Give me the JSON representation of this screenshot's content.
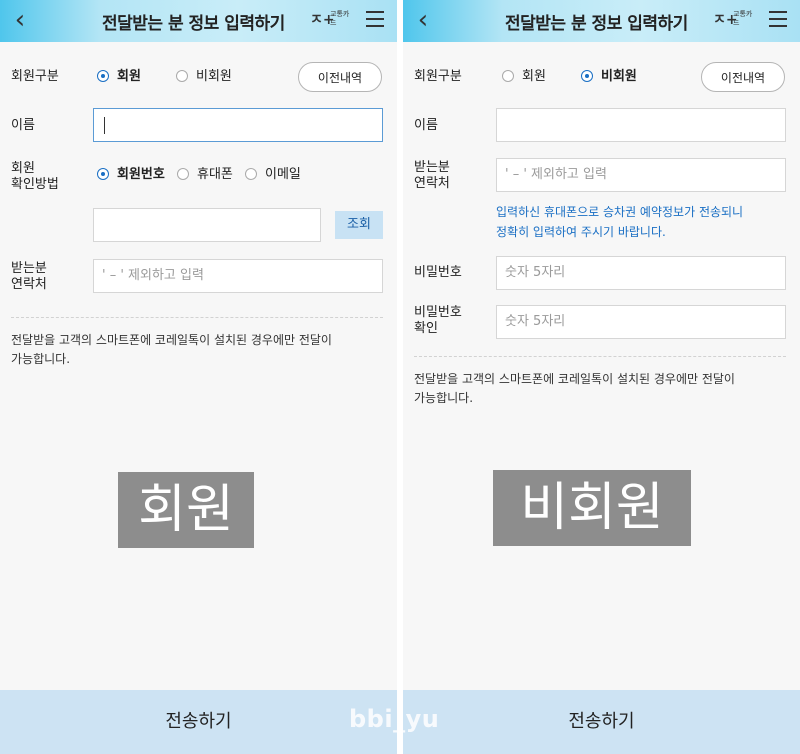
{
  "left": {
    "header": {
      "back_icon": "‹",
      "title": "전달받는 분 정보 입력하기",
      "logo_mark": "ㅈ+",
      "logo_text": "교통카드"
    },
    "member_type": {
      "label": "회원구분",
      "options": [
        "회원",
        "비회원"
      ],
      "selected": "회원",
      "history_button": "이전내역"
    },
    "name": {
      "label": "이름",
      "value": ""
    },
    "verify": {
      "label_line1": "회원",
      "label_line2": "확인방법",
      "options": [
        "회원번호",
        "휴대폰",
        "이메일"
      ],
      "selected": "회원번호"
    },
    "lookup": {
      "value": "",
      "button": "조회"
    },
    "contact": {
      "label_line1": "받는분",
      "label_line2": "연락처",
      "placeholder": "' – ' 제외하고 입력"
    },
    "notice_line1": "전달받을 고객의 스마트폰에 코레일톡이 설치된 경우에만 전달이",
    "notice_line2": "가능합니다.",
    "overlay_text": "회원",
    "submit": "전송하기"
  },
  "right": {
    "header": {
      "back_icon": "‹",
      "title": "전달받는 분 정보 입력하기",
      "logo_mark": "ㅈ+",
      "logo_text": "교통카드"
    },
    "member_type": {
      "label": "회원구분",
      "options": [
        "회원",
        "비회원"
      ],
      "selected": "비회원",
      "history_button": "이전내역"
    },
    "name": {
      "label": "이름",
      "value": ""
    },
    "contact": {
      "label_line1": "받는분",
      "label_line2": "연락처",
      "placeholder": "' – ' 제외하고 입력"
    },
    "contact_note_line1": "입력하신 휴대폰으로 승차권 예약정보가 전송되니",
    "contact_note_line2": "정확히 입력하여 주시기 바랍니다.",
    "password": {
      "label": "비밀번호",
      "placeholder": "숫자 5자리"
    },
    "password_confirm": {
      "label_line1": "비밀번호",
      "label_line2": "확인",
      "placeholder": "숫자 5자리"
    },
    "notice_line1": "전달받을 고객의 스마트폰에 코레일톡이 설치된 경우에만 전달이",
    "notice_line2": "가능합니다.",
    "overlay_text": "비회원",
    "submit": "전송하기"
  },
  "watermark": "bbi_yu"
}
